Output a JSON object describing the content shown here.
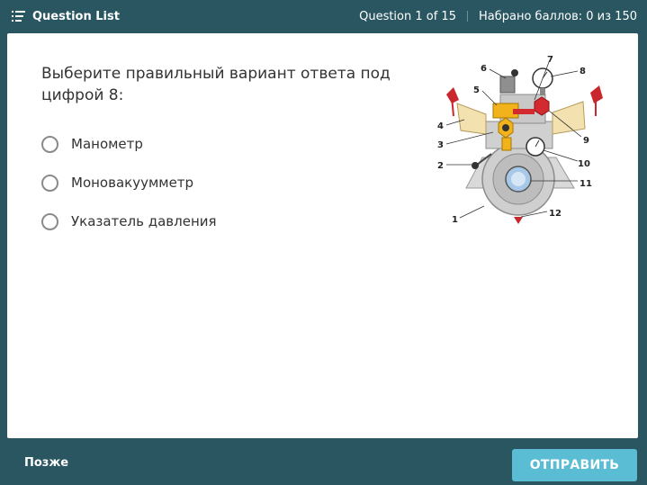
{
  "header": {
    "question_list_label": "Question List",
    "progress": "Question 1 of 15",
    "score": "Набрано баллов: 0 из 150"
  },
  "question": {
    "text": "Выберите правильный вариант ответа под цифрой 8:",
    "options": [
      {
        "label": "Манометр"
      },
      {
        "label": "Моновакуумметр"
      },
      {
        "label": "Указатель давления"
      }
    ]
  },
  "diagram": {
    "callouts": [
      "1",
      "2",
      "3",
      "4",
      "5",
      "6",
      "7",
      "8",
      "9",
      "10",
      "11",
      "12"
    ]
  },
  "footer": {
    "later_label": "Позже",
    "submit_label": "ОТПРАВИТЬ"
  },
  "colors": {
    "background": "#2a5661",
    "submit": "#5bbdd3"
  },
  "icons": {
    "question_list": "list-icon"
  }
}
